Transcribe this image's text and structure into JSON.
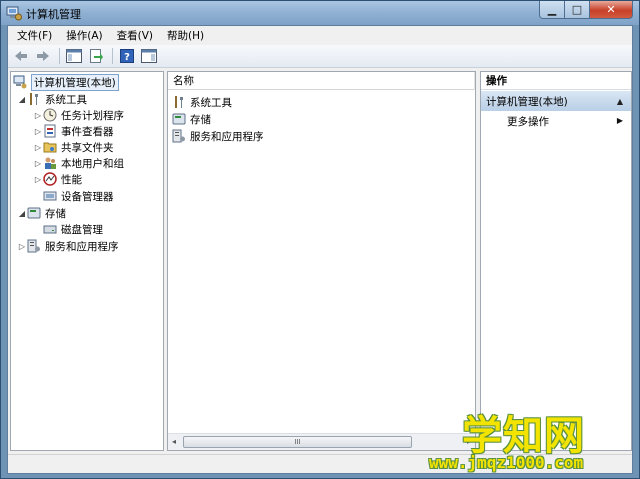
{
  "window": {
    "title": "计算机管理"
  },
  "caption_buttons": {
    "minimize": "▁",
    "maximize": "□",
    "close": "✕"
  },
  "menu": [
    "文件(F)",
    "操作(A)",
    "查看(V)",
    "帮助(H)"
  ],
  "toolbar": {
    "buttons": [
      "back-arrow-icon",
      "forward-arrow-icon",
      "show-hide-console-tree-icon",
      "export-list-icon",
      "help-icon",
      "show-hide-action-pane-icon"
    ]
  },
  "tree": {
    "root": "计算机管理(本地)",
    "items": [
      {
        "label": "系统工具",
        "toggle": "◢",
        "icon": "tools-icon"
      },
      {
        "label": "任务计划程序",
        "toggle": "▷",
        "icon": "clock-icon"
      },
      {
        "label": "事件查看器",
        "toggle": "▷",
        "icon": "event-viewer-icon"
      },
      {
        "label": "共享文件夹",
        "toggle": "▷",
        "icon": "shared-folder-icon"
      },
      {
        "label": "本地用户和组",
        "toggle": "▷",
        "icon": "users-icon"
      },
      {
        "label": "性能",
        "toggle": "▷",
        "icon": "performance-icon"
      },
      {
        "label": "设备管理器",
        "toggle": "",
        "icon": "device-manager-icon"
      },
      {
        "label": "存储",
        "toggle": "◢",
        "icon": "storage-icon"
      },
      {
        "label": "磁盘管理",
        "toggle": "",
        "icon": "disk-icon"
      },
      {
        "label": "服务和应用程序",
        "toggle": "▷",
        "icon": "services-icon"
      }
    ]
  },
  "list": {
    "column_header": "名称",
    "rows": [
      "系统工具",
      "存储",
      "服务和应用程序"
    ]
  },
  "scrollbar": {
    "left": "◂",
    "right": "▸",
    "grip": "III"
  },
  "actions": {
    "header": "操作",
    "section_title": "计算机管理(本地)",
    "section_arrow": "▲",
    "more": "更多操作",
    "more_arrow": "▶"
  },
  "watermark": {
    "text": "学知网",
    "url": "www.jmqz1000.com"
  },
  "colors": {
    "title_bar": "#8fb0d2",
    "selection_border": "#7da2ce",
    "actions_section": "#c9dcef",
    "watermark_fill": "#f2e400",
    "watermark_outline": "#5a8f3f"
  }
}
